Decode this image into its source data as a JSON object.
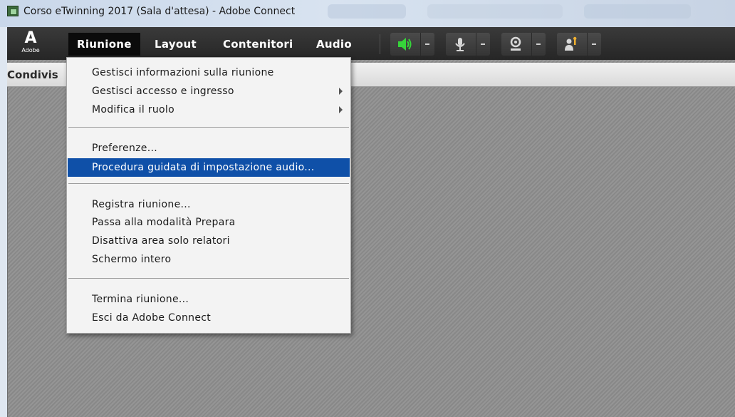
{
  "window": {
    "title": "Corso eTwinning 2017 (Sala d'attesa) - Adobe Connect"
  },
  "logo": {
    "mark": "A",
    "word": "Adobe"
  },
  "menubar": {
    "items": [
      "Riunione",
      "Layout",
      "Contenitori",
      "Audio"
    ],
    "active": "Riunione"
  },
  "toolbar": {
    "speaker_icon": "speaker-icon",
    "mic_icon": "microphone-icon",
    "camera_icon": "webcam-icon",
    "status_icon": "raise-hand-icon",
    "speaker_color": "#36d43a"
  },
  "panel": {
    "label": "Condivis"
  },
  "riunione_menu": {
    "groups": [
      [
        {
          "label": "Gestisci informazioni sulla riunione",
          "submenu": false
        },
        {
          "label": "Gestisci accesso e ingresso",
          "submenu": true
        },
        {
          "label": "Modifica il ruolo",
          "submenu": true
        }
      ],
      [
        {
          "label": "Preferenze...",
          "submenu": false
        },
        {
          "label": "Procedura guidata di impostazione audio...",
          "submenu": false,
          "highlighted": true
        }
      ],
      [
        {
          "label": "Registra riunione...",
          "submenu": false
        },
        {
          "label": "Passa alla modalità Prepara",
          "submenu": false
        },
        {
          "label": "Disattiva area solo relatori",
          "submenu": false
        },
        {
          "label": "Schermo intero",
          "submenu": false
        }
      ],
      [
        {
          "label": "Termina riunione...",
          "submenu": false
        },
        {
          "label": "Esci da Adobe Connect",
          "submenu": false
        }
      ]
    ]
  },
  "colors": {
    "menubar": "#2e2e2e",
    "highlight": "#0f50a8",
    "workspace": "#8f8f8f"
  }
}
